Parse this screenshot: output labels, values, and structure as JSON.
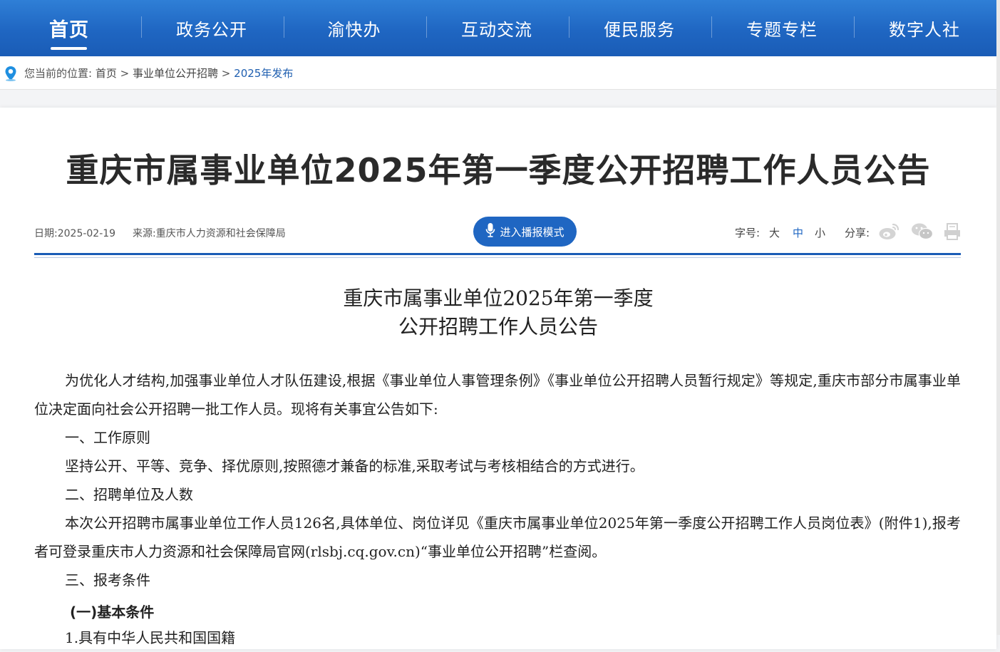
{
  "nav": {
    "items": [
      {
        "label": "首页",
        "active": true
      },
      {
        "label": "政务公开"
      },
      {
        "label": "渝快办"
      },
      {
        "label": "互动交流"
      },
      {
        "label": "便民服务"
      },
      {
        "label": "专题专栏"
      },
      {
        "label": "数字人社"
      }
    ]
  },
  "breadcrumb": {
    "prefix": "您当前的位置:",
    "home": "首页",
    "sep": ">",
    "section": "事业单位公开招聘",
    "current": "2025年发布"
  },
  "article": {
    "title": "重庆市属事业单位2025年第一季度公开招聘工作人员公告",
    "date_text": "日期:2025-02-19",
    "source_text": "来源:重庆市人力资源和社会保障局",
    "broadcast_label": "进入播报模式",
    "fontsize_label": "字号:",
    "fontsize_large": "大",
    "fontsize_medium": "中",
    "fontsize_small": "小",
    "share_label": "分享:",
    "doc_title_line1": "重庆市属事业单位2025年第一季度",
    "doc_title_line2": "公开招聘工作人员公告",
    "intro": "为优化人才结构,加强事业单位人才队伍建设,根据《事业单位人事管理条例》《事业单位公开招聘人员暂行规定》等规定,重庆市部分市属事业单位决定面向社会公开招聘一批工作人员。现将有关事宜公告如下:",
    "section1_heading": "一、工作原则",
    "section1_body": "坚持公开、平等、竞争、择优原则,按照德才兼备的标准,采取考试与考核相结合的方式进行。",
    "section2_heading": "二、招聘单位及人数",
    "section2_body": "本次公开招聘市属事业单位工作人员126名,具体单位、岗位详见《重庆市属事业单位2025年第一季度公开招聘工作人员岗位表》(附件1),报考者可登录重庆市人力资源和社会保障局官网(rlsbj.cq.gov.cn)“事业单位公开招聘”栏查阅。",
    "section3_heading": "三、报考条件",
    "subheading1": "(一)基本条件",
    "item1_partial": "1.具有中华人民共和国国籍"
  },
  "colors": {
    "nav_bg": "#1f66c2",
    "accent": "#1f66c2",
    "breadcrumb_current": "#1f5fb0"
  },
  "icons": {
    "location": "map-pin-icon",
    "mic": "microphone-icon",
    "weibo": "weibo-icon",
    "wechat": "wechat-icon",
    "print": "print-icon"
  }
}
